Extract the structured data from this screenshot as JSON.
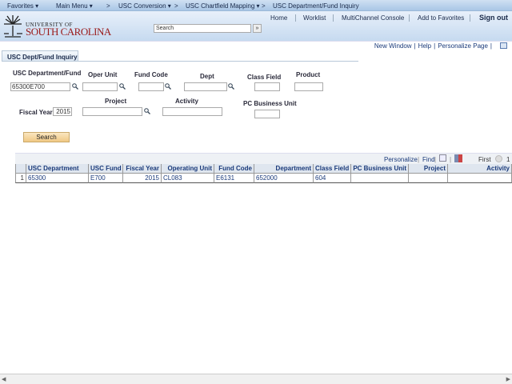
{
  "nav": {
    "favorites": "Favorites ▾",
    "main_menu": "Main Menu ▾",
    "crumb1": "USC Conversion ▾",
    "crumb2": "USC Chartfield Mapping ▾",
    "crumb3": "USC Department/Fund Inquiry",
    "sep": ">"
  },
  "header": {
    "logo_top": "UNIVERSITY OF",
    "logo_bottom": "SOUTH CAROLINA",
    "links": [
      "Home",
      "Worklist",
      "MultiChannel Console",
      "Add to Favorites"
    ],
    "signout": "Sign out",
    "search_placeholder": "Search",
    "go": "»"
  },
  "page_links": {
    "new_window": "New Window",
    "help": "Help",
    "personalize": "Personalize Page",
    "sep": "|"
  },
  "tab": "USC Dept/Fund Inquiry",
  "form": {
    "dept_fund_label": "USC Department/Fund",
    "dept_fund_value": "65300E700",
    "oper_unit_label": "Oper Unit",
    "fund_code_label": "Fund Code",
    "dept_label": "Dept",
    "class_field_label": "Class Field",
    "product_label": "Product",
    "fiscal_year_label": "Fiscal Year",
    "fiscal_year_value": "2015",
    "project_label": "Project",
    "activity_label": "Activity",
    "pc_bu_label": "PC Business Unit",
    "search_button": "Search"
  },
  "grid": {
    "personalize": "Personalize",
    "find": "Find",
    "first": "First",
    "page": "1",
    "sep": "|",
    "columns": [
      "USC Department",
      "USC Fund",
      "Fiscal Year",
      "Operating Unit",
      "Fund Code",
      "Department",
      "Class Field",
      "PC Business Unit",
      "Project",
      "Activity"
    ],
    "rows": [
      {
        "num": "1",
        "cells": [
          "65300",
          "E700",
          "2015",
          "CL083",
          "E6131",
          "652000",
          "604",
          "",
          "",
          ""
        ]
      }
    ]
  }
}
